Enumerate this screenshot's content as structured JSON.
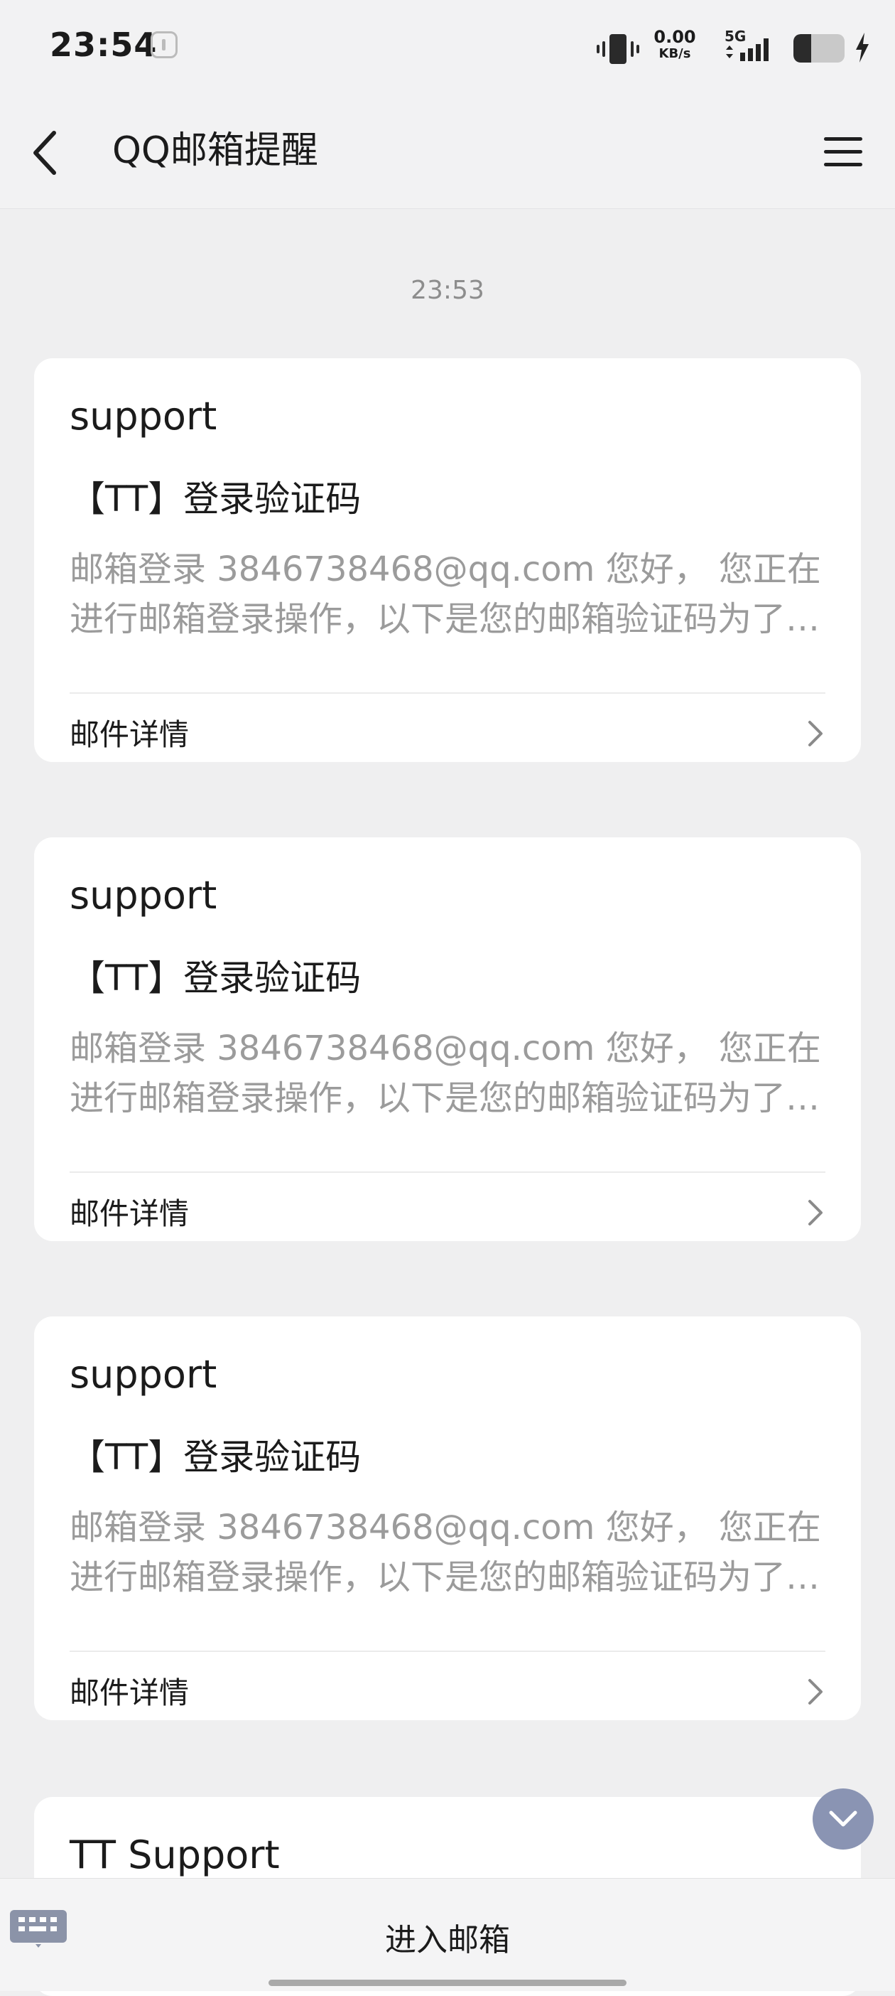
{
  "status_bar": {
    "time": "23:54",
    "net_speed_value": "0.00",
    "net_speed_unit": "KB/s",
    "network_type": "5G",
    "battery_level": 0.35
  },
  "header": {
    "title": "QQ邮箱提醒"
  },
  "timestamp": "23:53",
  "cards": [
    {
      "sender": "support",
      "subject": "【TT】登录验证码",
      "preview": "邮箱登录 3846738468@qq.com 您好， 您正在进行邮箱登录操作，以下是您的邮箱验证码为了保障您的账号安全",
      "detail_label": "邮件详情"
    },
    {
      "sender": "support",
      "subject": "【TT】登录验证码",
      "preview": "邮箱登录 3846738468@qq.com 您好， 您正在进行邮箱登录操作，以下是您的邮箱验证码为了保障您的账号安全",
      "detail_label": "邮件详情"
    },
    {
      "sender": "support",
      "subject": "【TT】登录验证码",
      "preview": "邮箱登录 3846738468@qq.com 您好， 您正在进行邮箱登录操作，以下是您的邮箱验证码为了保障您的账号安全",
      "detail_label": "邮件详情"
    }
  ],
  "partial_card": {
    "sender": "TT Support"
  },
  "bottom_bar": {
    "action_label": "进入邮箱"
  },
  "icons": {
    "back": "back-arrow-icon",
    "menu": "hamburger-menu-icon",
    "chevron": "chevron-right-icon",
    "scroll_down": "chevron-down-icon",
    "keyboard": "keyboard-icon"
  },
  "colors": {
    "background": "#efeff0",
    "card": "#ffffff",
    "preview_text": "#9b9b9b",
    "scroll_button": "#8a94b3"
  }
}
